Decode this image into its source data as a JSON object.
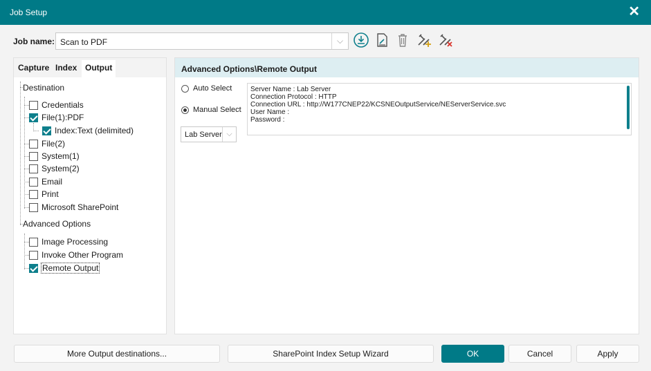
{
  "window": {
    "title": "Job Setup",
    "close_glyph": "✕"
  },
  "job": {
    "label": "Job name:",
    "value": "Scan to PDF",
    "dropdown_glyph": "⌵"
  },
  "toolbar": {
    "icons": [
      "download-icon",
      "edit-document-icon",
      "trash-icon",
      "tools-add-icon",
      "tools-remove-icon"
    ],
    "accent_color": "#0e7f8c"
  },
  "tabs": [
    {
      "label": "Capture"
    },
    {
      "label": "Index"
    },
    {
      "label": "Output",
      "active": true
    }
  ],
  "tree": {
    "destination": {
      "header": "Destination",
      "items": [
        {
          "label": "Credentials",
          "checked": false
        },
        {
          "label": "File(1):PDF",
          "checked": true
        },
        {
          "label": "Index:Text (delimited)",
          "checked": true
        },
        {
          "label": "File(2)",
          "checked": false
        },
        {
          "label": "System(1)",
          "checked": false
        },
        {
          "label": "System(2)",
          "checked": false
        },
        {
          "label": "Email",
          "checked": false
        },
        {
          "label": "Print",
          "checked": false
        },
        {
          "label": "Microsoft SharePoint",
          "checked": false
        }
      ]
    },
    "advanced": {
      "header": "Advanced Options",
      "items": [
        {
          "label": "Image Processing",
          "checked": false
        },
        {
          "label": "Invoke Other Program",
          "checked": false
        },
        {
          "label": "Remote Output",
          "checked": true
        }
      ]
    }
  },
  "remote": {
    "header": "Advanced Options\\Remote Output",
    "auto_select": "Auto Select",
    "manual_select": "Manual Select",
    "selected_mode": "manual",
    "server_value": "Lab Server",
    "dropdown_glyph": "⌵",
    "info_lines": [
      "Server Name : Lab Server",
      "Connection Protocol : HTTP",
      "Connection URL : http://W177CNEP22/KCSNEOutputService/NEServerService.svc",
      "User Name :",
      "Password :"
    ]
  },
  "buttons": {
    "more_output": "More Output destinations...",
    "sharepoint_wizard": "SharePoint Index Setup Wizard",
    "ok": "OK",
    "cancel": "Cancel",
    "apply": "Apply"
  }
}
